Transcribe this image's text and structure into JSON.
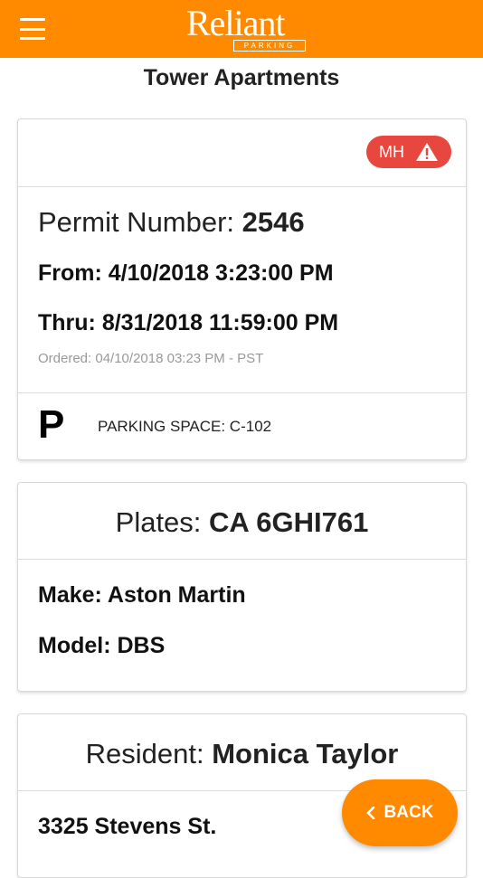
{
  "header": {
    "logo_word": "Reliant",
    "logo_sub": "PARKING",
    "menu_icon": "hamburger-icon"
  },
  "page": {
    "title": "Tower Apartments"
  },
  "permit": {
    "badge_label": "MH",
    "badge_icon": "warning-icon",
    "number_label": "Permit Number: ",
    "number": "2546",
    "from_label": "From: ",
    "from": "4/10/2018 3:23:00 PM",
    "thru_label": "Thru: ",
    "thru": "8/31/2018 11:59:00 PM",
    "ordered": "Ordered: 04/10/2018 03:23 PM - PST",
    "parking_icon": "P",
    "parking_space": "PARKING SPACE:  C-102"
  },
  "vehicle": {
    "plates_label": "Plates: ",
    "plates": "CA 6GHI761",
    "make_label": "Make: ",
    "make": "Aston Martin",
    "model_label": "Model: ",
    "model": "DBS"
  },
  "resident": {
    "label": "Resident: ",
    "name": "Monica Taylor",
    "address": "3325 Stevens St."
  },
  "back_button": {
    "label": "BACK",
    "icon": "chevron-left-icon"
  },
  "colors": {
    "brand": "#ff8a00",
    "badge": "#e8473f"
  }
}
